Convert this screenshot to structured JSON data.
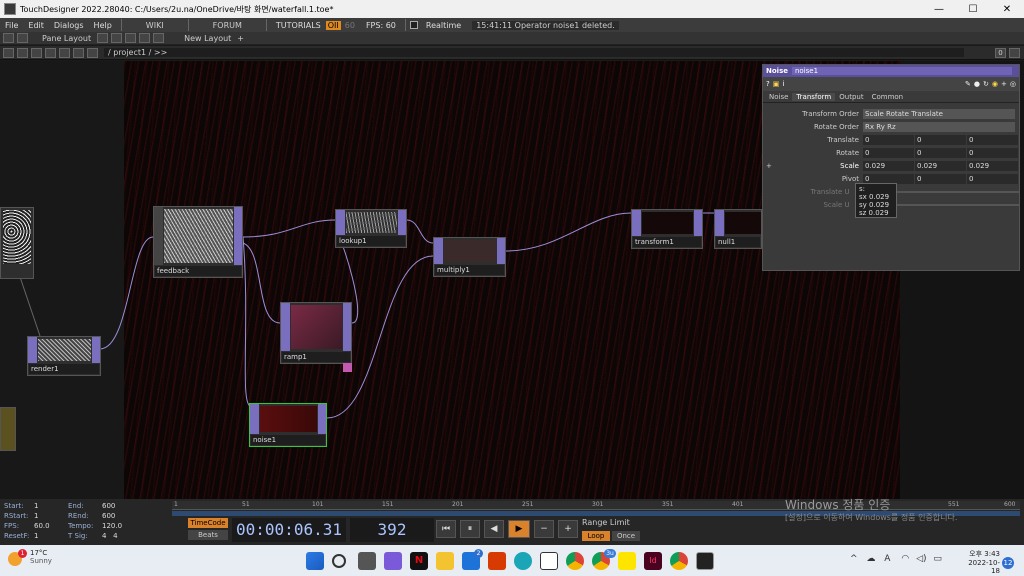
{
  "titlebar": {
    "title": "TouchDesigner 2022.28040: C:/Users/2u.na/OneDrive/바탕 화면/waterfall.1.toe*",
    "minimize": "—",
    "maximize": "☐",
    "close": "✕"
  },
  "menu": {
    "items": [
      "File",
      "Edit",
      "Dialogs",
      "Help"
    ],
    "tabs": [
      "WIKI",
      "FORUM",
      "TUTORIALS"
    ],
    "oi": "OII",
    "fps_small": "60",
    "fps_label": "FPS: 60",
    "realtime": "Realtime",
    "status": "15:41:11 Operator noise1 deleted."
  },
  "panebar": {
    "pane_layout": "Pane Layout",
    "new_layout": "New Layout",
    "plus": "+"
  },
  "pathbar": {
    "path": "/ project1 / >>",
    "right_0": "0"
  },
  "nodes": {
    "feedback": "feedback",
    "lookup1": "lookup1",
    "multiply1": "multiply1",
    "transform1": "transform1",
    "null1": "null1",
    "ramp1": "ramp1",
    "render1": "render1",
    "noise1": "noise1"
  },
  "params": {
    "op_type": "Noise",
    "op_name": "noise1",
    "tabs": [
      "Noise",
      "Transform",
      "Output",
      "Common"
    ],
    "active_tab": "Transform",
    "transform_order_label": "Transform Order",
    "transform_order_value": "Scale Rotate Translate",
    "rotate_order_label": "Rotate Order",
    "rotate_order_value": "Rx Ry Rz",
    "translate_label": "Translate",
    "translate": [
      "0",
      "0",
      "0"
    ],
    "rotate_label": "Rotate",
    "rotate": [
      "0",
      "0",
      "0"
    ],
    "scale_label": "Scale",
    "scale": [
      "0.029",
      "0.029",
      "0.029"
    ],
    "pivot_label": "Pivot",
    "pivot": [
      "0",
      "0",
      "0"
    ],
    "translate_unit_label": "Translate U",
    "scale_unit_label": "Scale U",
    "plus": "+"
  },
  "tooltip": {
    "title": "s:",
    "sx": "sx  0.029",
    "sy": "sy  0.029",
    "sz": "sz  0.029"
  },
  "timeline": {
    "start_label": "Start:",
    "start": "1",
    "end_label": "End:",
    "end": "600",
    "rstart_label": "RStart:",
    "rstart": "1",
    "rend_label": "REnd:",
    "rend": "600",
    "fps_label": "FPS:",
    "fps": "60.0",
    "tempo_label": "Tempo:",
    "tempo": "120.0",
    "resetf_label": "ResetF:",
    "resetf": "1",
    "tsig_label": "T Sig:",
    "tsig_a": "4",
    "tsig_b": "4",
    "ruler": [
      "1",
      "51",
      "101",
      "151",
      "201",
      "251",
      "301",
      "351",
      "401",
      "551",
      "600"
    ],
    "timecode": "TimeCode",
    "beats": "Beats",
    "time": "00:00:06.31",
    "frame": "392",
    "range_limit": "Range Limit",
    "loop": "Loop",
    "once": "Once",
    "watermark_title": "Windows 정품 인증",
    "watermark_sub": "[설정]으로 이동하여 Windows를 정품 인증합니다."
  },
  "taskbar": {
    "temp": "17°C",
    "weather": "Sunny",
    "time": "오후 3:43",
    "date": "2022-10-18",
    "lang": "A",
    "notif": "12",
    "badge_weather": "1",
    "badge_mail": "2",
    "badge_app": "3u"
  }
}
